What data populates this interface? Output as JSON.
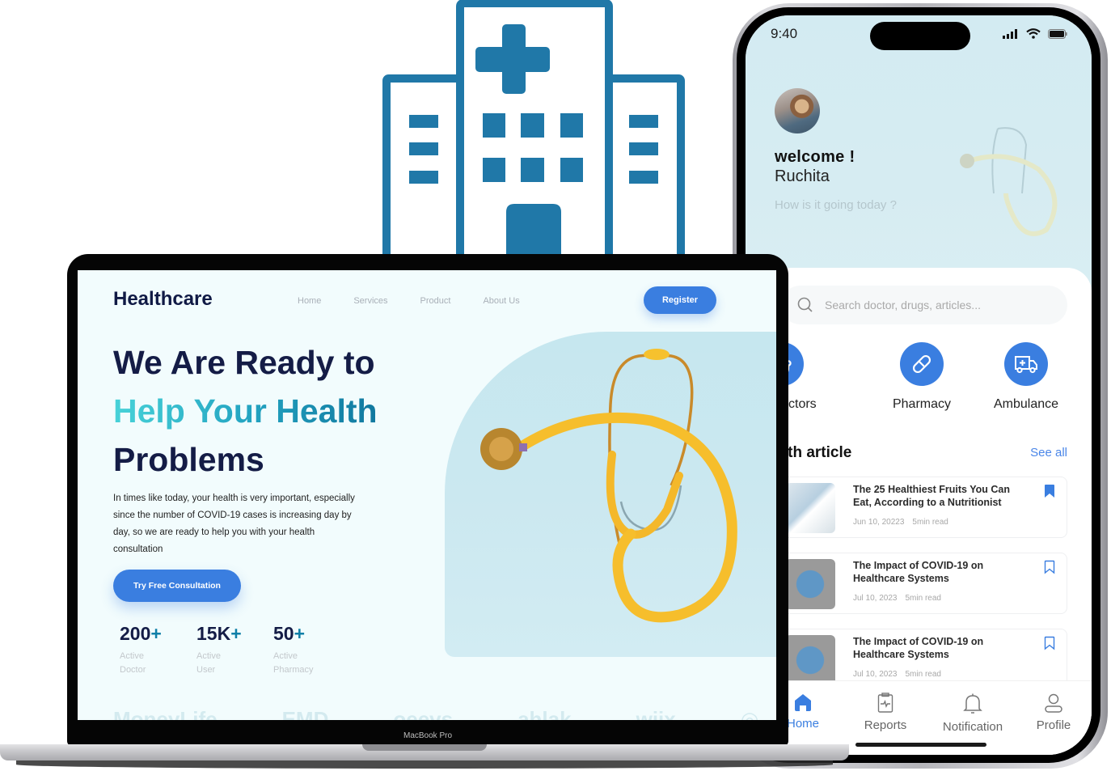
{
  "colors": {
    "brand_blue": "#3a7ee0",
    "hospital_blue": "#2078a8",
    "navy_text": "#141c46",
    "teal_accent": "#24a5c2",
    "stethoscope_yellow": "#f6c12e"
  },
  "hospital_icon": {
    "icon": "hospital-building-icon"
  },
  "laptop": {
    "device_label": "MacBook Pro",
    "website": {
      "logo": "Healthcare",
      "nav": [
        "Home",
        "Services",
        "Product",
        "About Us"
      ],
      "register_label": "Register",
      "headline": {
        "line1": "We Are Ready to",
        "line2": "Help Your Health",
        "line3": "Problems"
      },
      "intro": "In times like today, your health is very important, especially since the number of COVID-19 cases is increasing day by day, so we are ready to help you with your health consultation",
      "cta_label": "Try Free Consultation",
      "stats": [
        {
          "value": "200",
          "suffix": "+",
          "label_line1": "Active",
          "label_line2": "Doctor"
        },
        {
          "value": "15K",
          "suffix": "+",
          "label_line1": "Active",
          "label_line2": "User"
        },
        {
          "value": "50",
          "suffix": "+",
          "label_line1": "Active",
          "label_line2": "Pharmacy"
        }
      ],
      "partners": [
        "MoneyLife",
        "EMD",
        "oeevs",
        "ahlak",
        "wiix",
        "◎"
      ],
      "hero_image": "stethoscope-photo"
    }
  },
  "phone": {
    "status_bar": {
      "time": "9:40",
      "icons": [
        "signal-icon",
        "wifi-icon",
        "battery-icon"
      ]
    },
    "greeting": {
      "welcome": "welcome !",
      "name": "Ruchita",
      "tagline": "How is it going today ?"
    },
    "search": {
      "placeholder": "Search doctor, drugs, articles..."
    },
    "categories": [
      {
        "label": "Top Doctors",
        "icon": "stethoscope-icon"
      },
      {
        "label": "Pharmacy",
        "icon": "pill-icon"
      },
      {
        "label": "Ambulance",
        "icon": "ambulance-icon"
      }
    ],
    "articles_section": {
      "title": "Health article",
      "see_all": "See all"
    },
    "articles": [
      {
        "title": "The 25 Healthiest Fruits You Can Eat, According to a Nutritionist",
        "date": "Jun 10, 20223",
        "read_time": "5min read",
        "bookmarked": true,
        "thumb": "doctor-photo"
      },
      {
        "title": "The Impact of COVID-19 on Healthcare Systems",
        "date": "Jul 10, 2023",
        "read_time": "5min read",
        "bookmarked": false,
        "thumb": "covid-globe-photo"
      },
      {
        "title": "The Impact of COVID-19 on Healthcare Systems",
        "date": "Jul 10, 2023",
        "read_time": "5min read",
        "bookmarked": false,
        "thumb": "covid-globe-photo"
      }
    ],
    "tabbar": [
      {
        "label": "Home",
        "icon": "home-icon",
        "active": true
      },
      {
        "label": "Reports",
        "icon": "report-icon",
        "active": false
      },
      {
        "label": "Notification",
        "icon": "bell-icon",
        "active": false
      },
      {
        "label": "Profile",
        "icon": "user-icon",
        "active": false
      }
    ]
  }
}
